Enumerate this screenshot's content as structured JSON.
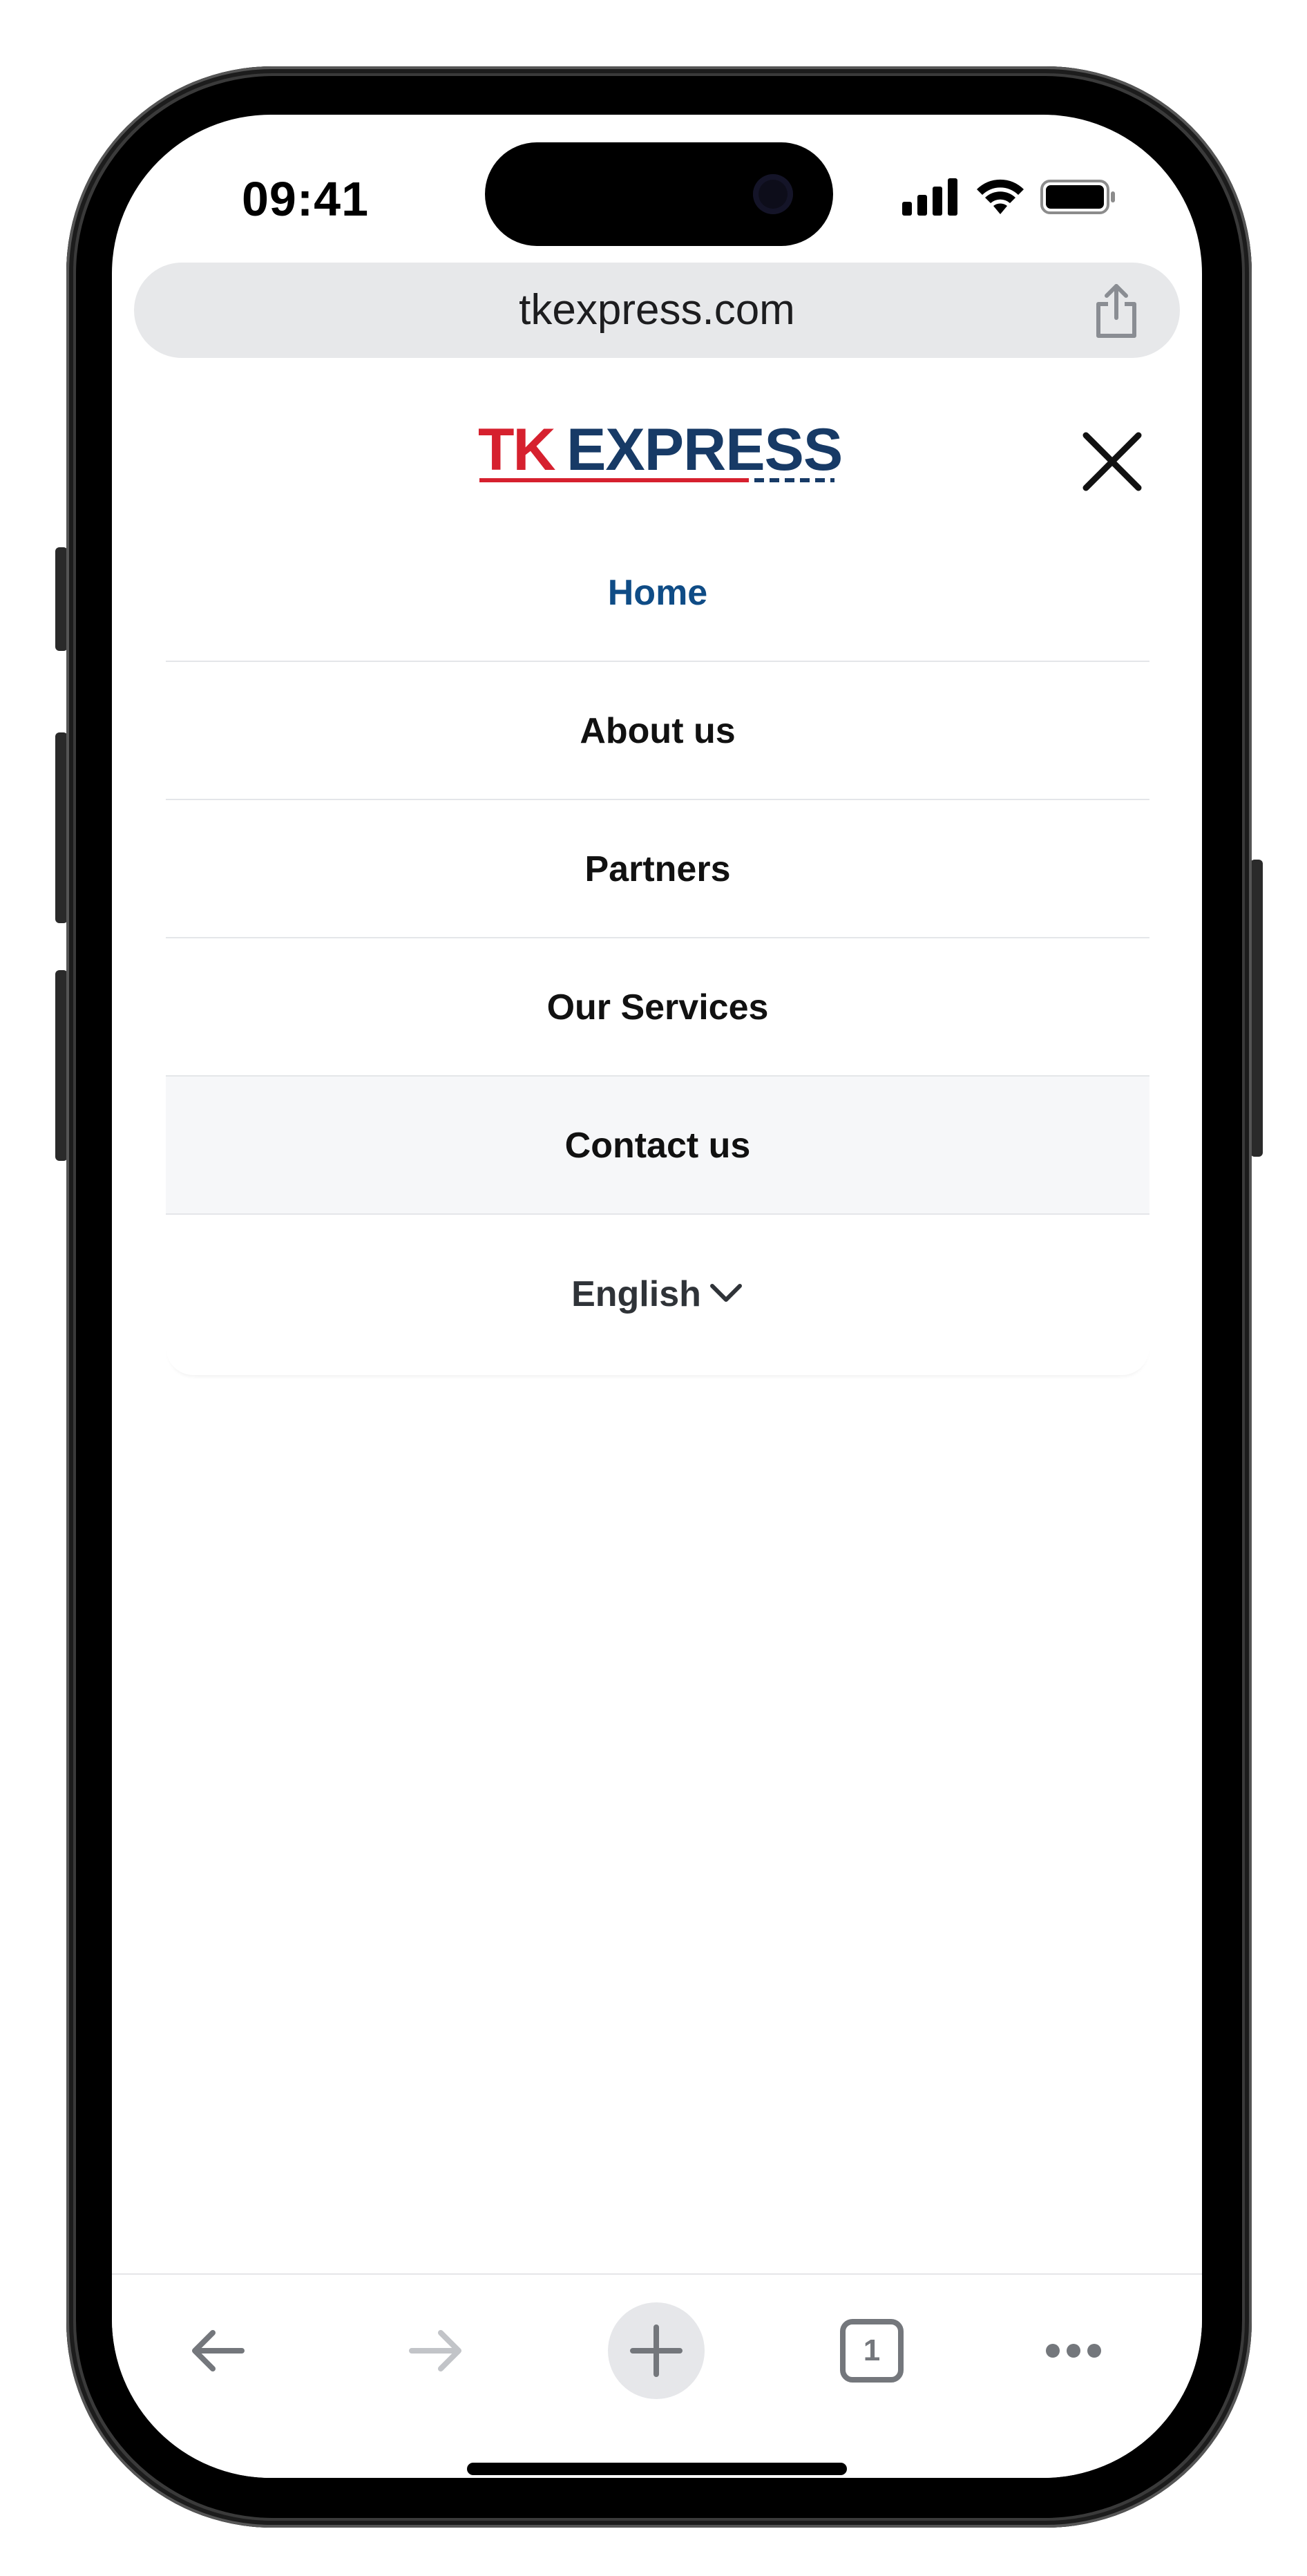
{
  "status_bar": {
    "time": "09:41",
    "signal_icon": "cellular-signal-icon",
    "wifi_icon": "wifi-icon",
    "battery_icon": "battery-icon"
  },
  "browser": {
    "url": "tkexpress.com",
    "share_icon": "share-icon"
  },
  "site": {
    "logo_prefix": "TK",
    "logo_suffix": "EXPRESS",
    "close_icon": "close-icon"
  },
  "menu": {
    "items": [
      {
        "label": "Home",
        "active": true
      },
      {
        "label": "About us"
      },
      {
        "label": "Partners"
      },
      {
        "label": "Our Services"
      },
      {
        "label": "Contact us",
        "highlighted": true
      }
    ],
    "language": "English",
    "language_icon": "chevron-down-icon"
  },
  "toolbar": {
    "back_icon": "arrow-left-icon",
    "forward_icon": "arrow-right-icon",
    "new_tab_icon": "plus-icon",
    "tabs_count": "1",
    "more_icon": "more-horizontal-icon"
  },
  "colors": {
    "brand_red": "#d6202e",
    "brand_navy": "#173a66",
    "active_link": "#0f4c86"
  }
}
